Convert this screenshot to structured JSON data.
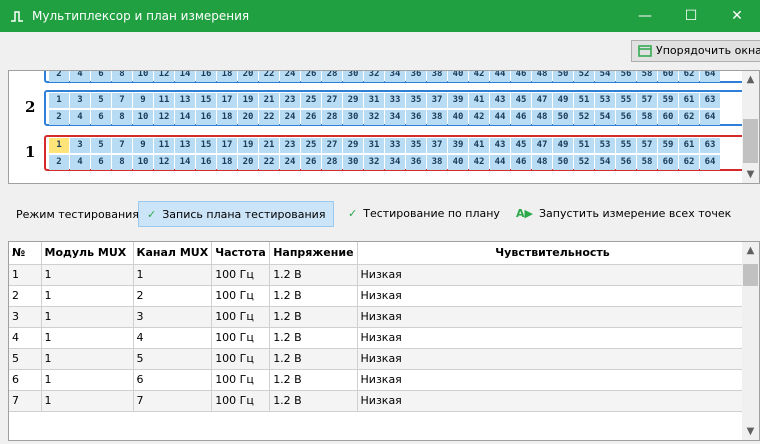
{
  "window": {
    "title": "Мультиплексор и план измерения",
    "controls": {
      "minimize": "—",
      "maximize": "☐",
      "close": "✕"
    },
    "accent": "#21a042"
  },
  "toolbar": {
    "arrange_label": "Упорядочить окна"
  },
  "mux_panel": {
    "channels_odd": [
      "1",
      "3",
      "5",
      "7",
      "9",
      "11",
      "13",
      "15",
      "17",
      "19",
      "21",
      "23",
      "25",
      "27",
      "29",
      "31",
      "33",
      "35",
      "37",
      "39",
      "41",
      "43",
      "45",
      "47",
      "49",
      "51",
      "53",
      "55",
      "57",
      "59",
      "61",
      "63"
    ],
    "channels_even": [
      "2",
      "4",
      "6",
      "8",
      "10",
      "12",
      "14",
      "16",
      "18",
      "20",
      "22",
      "24",
      "26",
      "28",
      "30",
      "32",
      "34",
      "36",
      "38",
      "40",
      "42",
      "44",
      "46",
      "48",
      "50",
      "52",
      "54",
      "56",
      "58",
      "60",
      "62",
      "64"
    ],
    "modules": [
      {
        "number": "",
        "selected": false
      },
      {
        "number": "2",
        "selected": false
      },
      {
        "number": "1",
        "selected": true,
        "active_channel": "1"
      }
    ],
    "colors": {
      "module_border": "#2e7fd8",
      "selected_border": "#d62a2a",
      "channel_bg": "#b7dcf3",
      "active_channel_bg": "#ffe47a"
    }
  },
  "mode": {
    "label": "Режим тестирования:",
    "buttons": [
      {
        "label": "Запись плана тестирования",
        "icon": "pencil-check-icon",
        "active": true
      },
      {
        "label": "Тестирование по плану",
        "icon": "list-check-icon",
        "active": false
      },
      {
        "label": "Запустить измерение всех точек",
        "icon": "a-play-icon",
        "active": false
      }
    ]
  },
  "table": {
    "headers": [
      "№",
      "Модуль MUX",
      "Канал MUX",
      "Частота",
      "Напряжение",
      "Чувствительность"
    ],
    "rows": [
      [
        "1",
        "1",
        "1",
        "100 Гц",
        "1.2 В",
        "Низкая"
      ],
      [
        "2",
        "1",
        "2",
        "100 Гц",
        "1.2 В",
        "Низкая"
      ],
      [
        "3",
        "1",
        "3",
        "100 Гц",
        "1.2 В",
        "Низкая"
      ],
      [
        "4",
        "1",
        "4",
        "100 Гц",
        "1.2 В",
        "Низкая"
      ],
      [
        "5",
        "1",
        "5",
        "100 Гц",
        "1.2 В",
        "Низкая"
      ],
      [
        "6",
        "1",
        "6",
        "100 Гц",
        "1.2 В",
        "Низкая"
      ],
      [
        "7",
        "1",
        "7",
        "100 Гц",
        "1.2 В",
        "Низкая"
      ]
    ]
  }
}
